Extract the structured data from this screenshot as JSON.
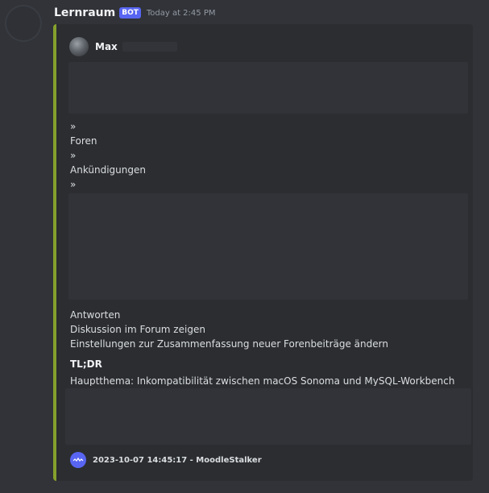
{
  "message": {
    "username": "Lernraum",
    "badge": "BOT",
    "timestamp": "Today at 2:45 PM"
  },
  "embed": {
    "accent_color": "#85a12b",
    "author": {
      "name": "Max"
    },
    "breadcrumb": {
      "sep1": "»",
      "item1": "Foren",
      "sep2": "»",
      "item2": "Ankündigungen",
      "sep3": "»"
    },
    "links": {
      "reply": "Antworten",
      "show_discussion": "Diskussion im Forum zeigen",
      "digest_settings": "Einstellungen zur Zusammenfassung neuer Forenbeiträge ändern"
    },
    "tldr_heading": "TL;DR",
    "summary": "Hauptthema: Inkompatibilität zwischen macOS Sonoma und MySQL-Workbench",
    "footer": {
      "text": "2023-10-07 14:45:17 - MoodleStalker"
    }
  }
}
